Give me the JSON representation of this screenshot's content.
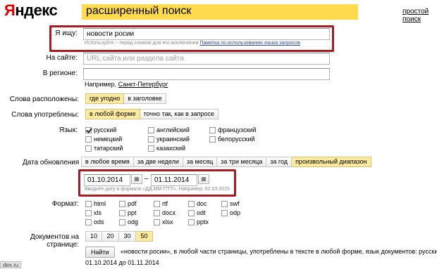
{
  "header": {
    "logo_first": "Я",
    "logo_rest": "ндекс",
    "title": "расширенный поиск",
    "simple_search_link": "простой поиск"
  },
  "query": {
    "label": "Я ищу:",
    "value": "новости росии",
    "hint_text": "Используйте ~ перед словом для его исключения",
    "hint_link": "Памятка по использованию языка запросов"
  },
  "site": {
    "label": "На сайте:",
    "placeholder": "URL сайта или раздела сайта"
  },
  "region": {
    "label": "В регионе:",
    "value": "",
    "example_prefix": "Например,",
    "example_link": "Санкт-Петербург"
  },
  "words_location": {
    "label": "Слова расположены:",
    "options": [
      "где угодно",
      "в заголовке"
    ],
    "selected": "где угодно"
  },
  "words_form": {
    "label": "Слова употреблены:",
    "options": [
      "в любой форме",
      "точно так, как в запросе"
    ],
    "selected": "в любой форме"
  },
  "language": {
    "label": "Язык:",
    "items": [
      {
        "label": "русский",
        "checked": true
      },
      {
        "label": "английский",
        "checked": false
      },
      {
        "label": "французский",
        "checked": false
      },
      {
        "label": "немецкий",
        "checked": false
      },
      {
        "label": "украинский",
        "checked": false
      },
      {
        "label": "белорусский",
        "checked": false
      },
      {
        "label": "татарский",
        "checked": false
      },
      {
        "label": "казахский",
        "checked": false
      }
    ]
  },
  "update_date": {
    "label": "Дата обновления",
    "help": "?",
    "options": [
      "в любое время",
      "за две недели",
      "за месяц",
      "за три месяца",
      "за год",
      "произвольный диапазон"
    ],
    "selected": "произвольный диапазон",
    "from": "01.10.2014",
    "dash": "–",
    "to": "01.11.2014",
    "hint": "Вводите дату в формате «ДД.ММ.ГГГГ». Например, 02.03.2015"
  },
  "format": {
    "label": "Формат:",
    "items": [
      {
        "label": "html",
        "checked": false
      },
      {
        "label": "pdf",
        "checked": false
      },
      {
        "label": "rtf",
        "checked": false
      },
      {
        "label": "doc",
        "checked": false
      },
      {
        "label": "swf",
        "checked": false
      },
      {
        "label": "xls",
        "checked": false
      },
      {
        "label": "ppt",
        "checked": false
      },
      {
        "label": "docx",
        "checked": false
      },
      {
        "label": "odt",
        "checked": false
      },
      {
        "label": "odp",
        "checked": false
      },
      {
        "label": "ods",
        "checked": false
      },
      {
        "label": "odg",
        "checked": false
      },
      {
        "label": "xlsx",
        "checked": false
      },
      {
        "label": "pptx",
        "checked": false
      }
    ]
  },
  "per_page": {
    "label": "Документов на странице:",
    "options": [
      "10",
      "20",
      "30",
      "50"
    ],
    "selected": "50"
  },
  "submit": {
    "button": "Найти",
    "summary_line1": "«новости росии», в любой части страницы, употреблены в тексте в любой форме, язык документов: русский, от",
    "summary_line2": "01.10.2014 до 01.11.2014"
  },
  "status_bar": {
    "text": "dex.ru"
  },
  "colors": {
    "accent_yellow": "#ffdb4d",
    "highlight_red": "#a51c24",
    "logo_red": "#e00000",
    "active_segment": "#ffeba0"
  }
}
